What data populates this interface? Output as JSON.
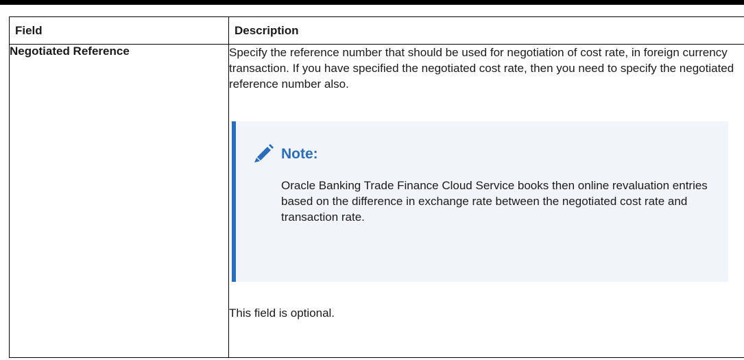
{
  "table": {
    "headers": {
      "field": "Field",
      "description": "Description"
    },
    "rows": [
      {
        "field": "Negotiated Reference",
        "description": "Specify the reference number that should be used for negotiation of cost rate, in foreign currency transaction. If you have specified the negotiated cost rate, then you need to specify the negotiated reference number also.",
        "note": {
          "icon": "pencil-icon",
          "title": "Note:",
          "body": "Oracle Banking Trade Finance Cloud Service books then online revaluation entries based on the difference in exchange rate between the negotiated cost rate and transaction rate."
        },
        "footer": "This field is optional."
      }
    ]
  },
  "colors": {
    "note_accent": "#2a6ebb",
    "note_background": "#f1f5fa",
    "rule": "#000000"
  }
}
